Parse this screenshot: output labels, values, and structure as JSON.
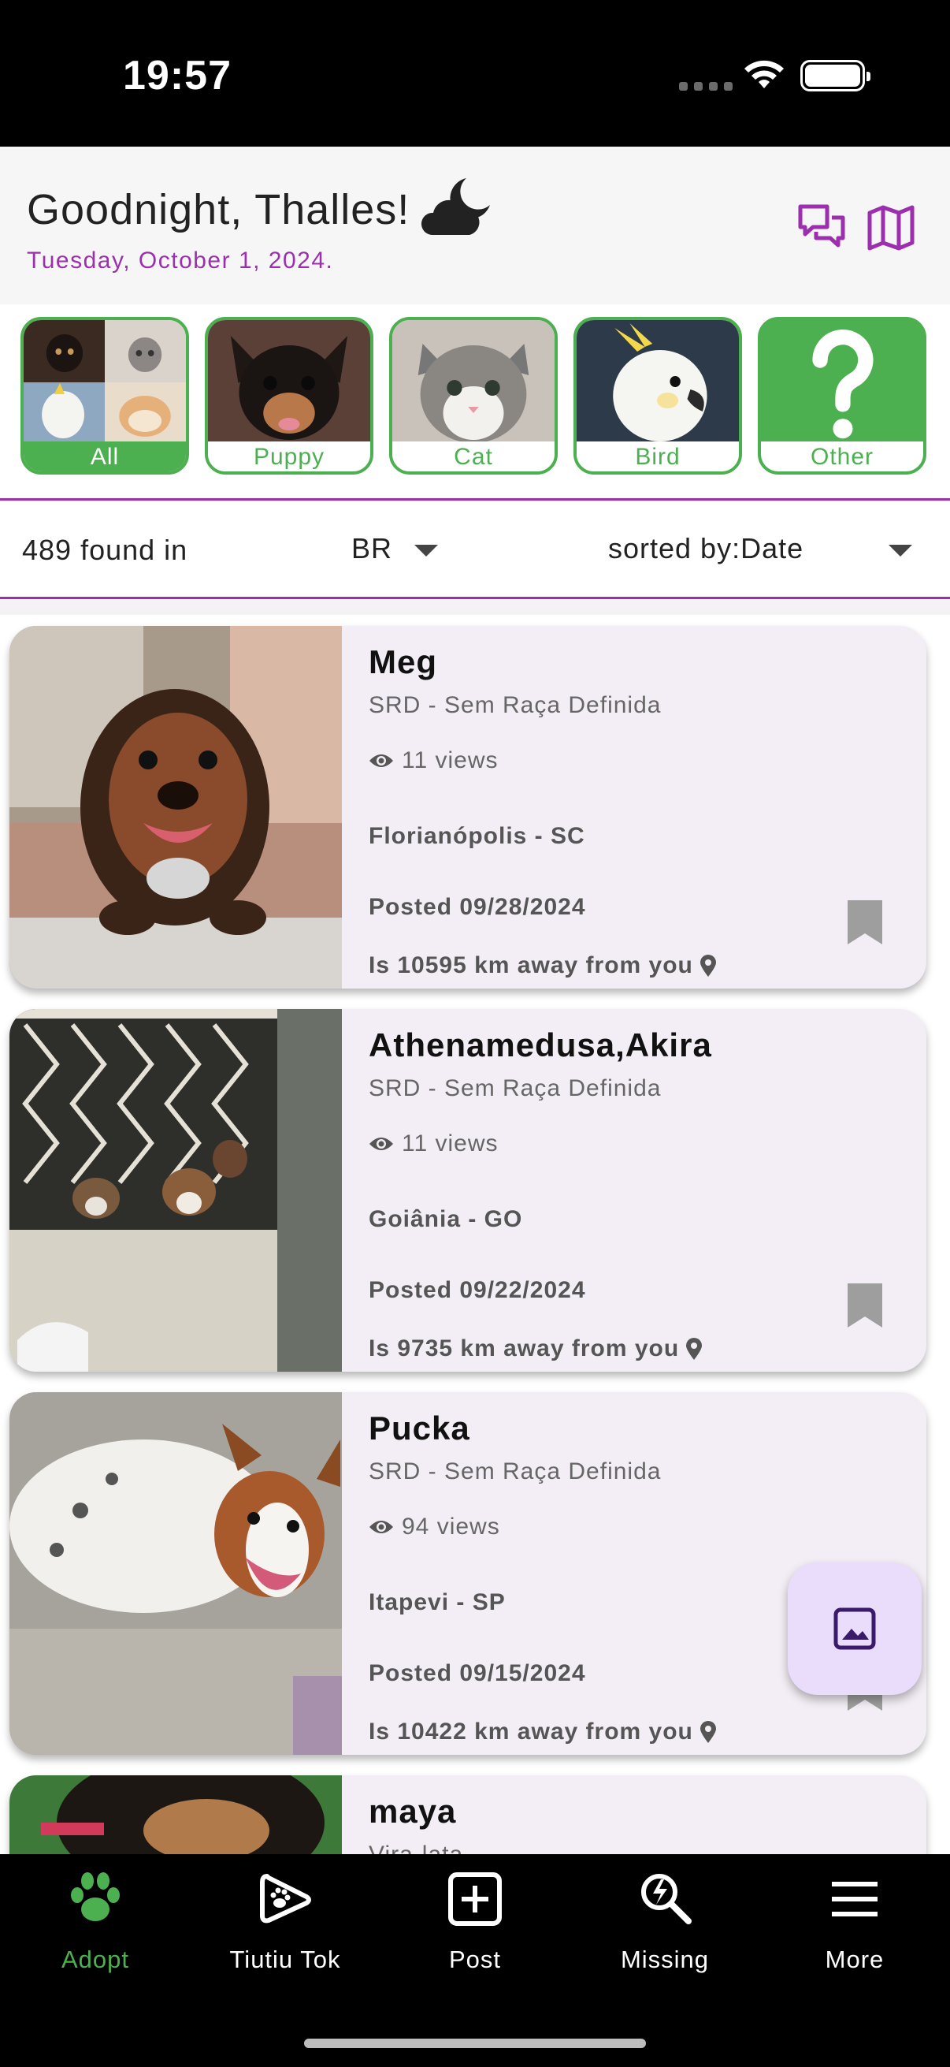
{
  "status_bar": {
    "time": "19:57"
  },
  "header": {
    "greeting": "Goodnight, Thalles!",
    "date": "Tuesday, October 1, 2024.",
    "icons": [
      "chat-bubbles-icon",
      "map-icon"
    ]
  },
  "categories": [
    {
      "label": "All",
      "active": true
    },
    {
      "label": "Puppy",
      "active": false
    },
    {
      "label": "Cat",
      "active": false
    },
    {
      "label": "Bird",
      "active": false
    },
    {
      "label": "Other",
      "active": false
    }
  ],
  "filter": {
    "found_text": "489 found in",
    "country": "BR",
    "sort_text": "sorted by:Date"
  },
  "listings": [
    {
      "name": "Meg",
      "breed": "SRD - Sem Raça Definida",
      "views": "11 views",
      "location": "Florianópolis - SC",
      "posted": "Posted 09/28/2024",
      "distance": "Is 10595 km away from you"
    },
    {
      "name": "Athenamedusa,Akira",
      "breed": "SRD - Sem Raça Definida",
      "views": "11 views",
      "location": "Goiânia - GO",
      "posted": "Posted 09/22/2024",
      "distance": "Is 9735 km away from you"
    },
    {
      "name": "Pucka",
      "breed": "SRD - Sem Raça Definida",
      "views": "94 views",
      "location": "Itapevi - SP",
      "posted": "Posted 09/15/2024",
      "distance": "Is 10422 km away from you"
    },
    {
      "name": "maya",
      "breed": "Vira-lata"
    }
  ],
  "bottom_nav": [
    {
      "label": "Adopt",
      "icon": "paw-icon",
      "active": true
    },
    {
      "label": "Tiutiu Tok",
      "icon": "play-paw-icon",
      "active": false
    },
    {
      "label": "Post",
      "icon": "plus-square-icon",
      "active": false
    },
    {
      "label": "Missing",
      "icon": "search-bolt-icon",
      "active": false
    },
    {
      "label": "More",
      "icon": "menu-icon",
      "active": false
    }
  ],
  "colors": {
    "accent_purple": "#9b2fae",
    "accent_green": "#4caf50",
    "card_bg": "#f3eef5",
    "fab_bg": "#eadcfb"
  }
}
